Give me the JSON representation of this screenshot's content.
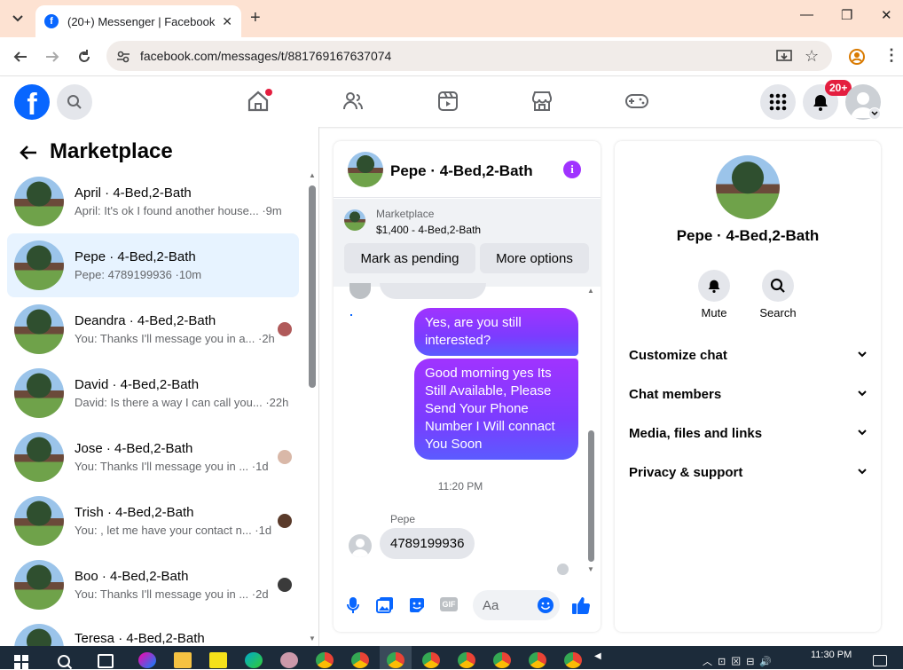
{
  "browser": {
    "tab_title": "(20+) Messenger | Facebook",
    "url": "facebook.com/messages/t/881769167637074"
  },
  "fb": {
    "notif_badge": "20+"
  },
  "left": {
    "title": "Marketplace",
    "conversations": [
      {
        "name": "April · 4-Bed,2-Bath",
        "preview": "April: It's ok I found another house... ·9m"
      },
      {
        "name": "Pepe · 4-Bed,2-Bath",
        "preview": "Pepe: 4789199936 ·10m"
      },
      {
        "name": "Deandra · 4-Bed,2-Bath",
        "preview": "You: Thanks I'll message you in a... ·2h"
      },
      {
        "name": "David · 4-Bed,2-Bath",
        "preview": "David: Is there a way I can call you... ·22h"
      },
      {
        "name": "Jose · 4-Bed,2-Bath",
        "preview": "You: Thanks I'll message you in ... ·1d"
      },
      {
        "name": "Trish · 4-Bed,2-Bath",
        "preview": "You: , let me have your contact n... ·1d"
      },
      {
        "name": "Boo · 4-Bed,2-Bath",
        "preview": "You: Thanks I'll message you in ... ·2d"
      },
      {
        "name": "Teresa · 4-Bed,2-Bath",
        "preview": ""
      }
    ]
  },
  "chat": {
    "title": "Pepe · 4-Bed,2-Bath",
    "listing_source": "Marketplace",
    "listing_detail": "$1,400 - 4-Bed,2-Bath",
    "btn_pending": "Mark as pending",
    "btn_more": "More options",
    "msg1": "Yes, are you still interested?",
    "msg2": "Good morning yes Its Still Available, Please Send Your Phone Number I Will connact You Soon",
    "timestamp": "11:20 PM",
    "sender": "Pepe",
    "msg3": "4789199936",
    "input_placeholder": "Aa"
  },
  "info": {
    "title": "Pepe · 4-Bed,2-Bath",
    "mute": "Mute",
    "search": "Search",
    "sections": [
      "Customize chat",
      "Chat members",
      "Media, files and links",
      "Privacy & support"
    ]
  },
  "taskbar": {
    "time": "11:30 PM"
  },
  "colors": {
    "fb_blue": "#0866ff",
    "purple": "#a033ff",
    "selected_bg": "#e7f3ff"
  }
}
